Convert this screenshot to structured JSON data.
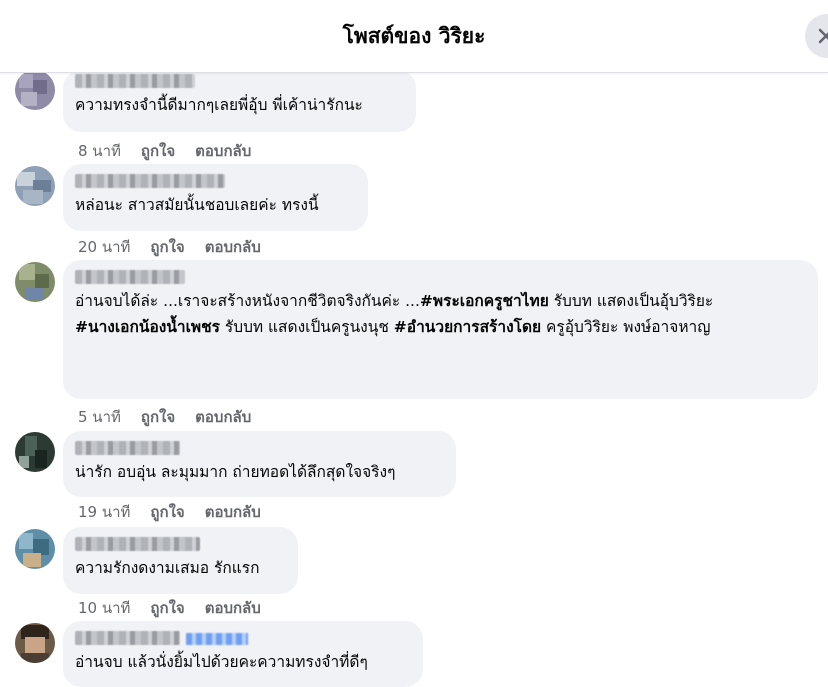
{
  "header": {
    "title": "โพสต์ของ วิริยะ"
  },
  "comments": [
    {
      "text": "ความทรงจำนี้ดีมากๆเลยพี่อุ้บ พี่เค้าน่ารักนะ",
      "time": "8 นาที",
      "like": "ถูกใจ",
      "reply": "ตอบกลับ",
      "avatar_color": "#8f8aa6"
    },
    {
      "text": "หล่อนะ สาวสมัยนั้นชอบเลยค่ะ ทรงนี้",
      "time": "20 นาที",
      "like": "ถูกใจ",
      "reply": "ตอบกลับ",
      "avatar_color": "#8ea0b6"
    },
    {
      "text_parts": [
        {
          "t": "อ่านจบได้ล่ะ ...เราจะสร้างหนังจากชีวิตจริงกันค่ะ ...",
          "bold": false
        },
        {
          "t": "#พระเอกครูชาไทย",
          "bold": true
        },
        {
          "t": " รับบท แสดงเป็นอุ้บวิริยะ\n",
          "bold": false
        },
        {
          "t": "#นางเอกน้องน้ำเพชร",
          "bold": true
        },
        {
          "t": " รับบท แสดงเป็นครูนงนุช ",
          "bold": false
        },
        {
          "t": "#อำนวยการสร้างโดย",
          "bold": true
        },
        {
          "t": " ครูอุ้บวิริยะ พงษ์อาจหาญ",
          "bold": false
        }
      ],
      "time": "5 นาที",
      "like": "ถูกใจ",
      "reply": "ตอบกลับ",
      "avatar_color": "#7e8c6a"
    },
    {
      "text": "น่ารัก อบอุ่น ละมุมมาก ถ่ายทอดได้ลึกสุดใจจริงๆ",
      "time": "19 นาที",
      "like": "ถูกใจ",
      "reply": "ตอบกลับ",
      "avatar_color": "#2b3a33"
    },
    {
      "text": "ความรักงดงามเสมอ รักแรก",
      "time": "10 นาที",
      "like": "ถูกใจ",
      "reply": "ตอบกลับ",
      "avatar_color": "#5f8fa8"
    },
    {
      "text": "อ่านจบ แล้วนั่งยิ้มไปด้วยคะความทรงจำที่ดีๆ",
      "avatar_color": "#6b5a48"
    }
  ]
}
